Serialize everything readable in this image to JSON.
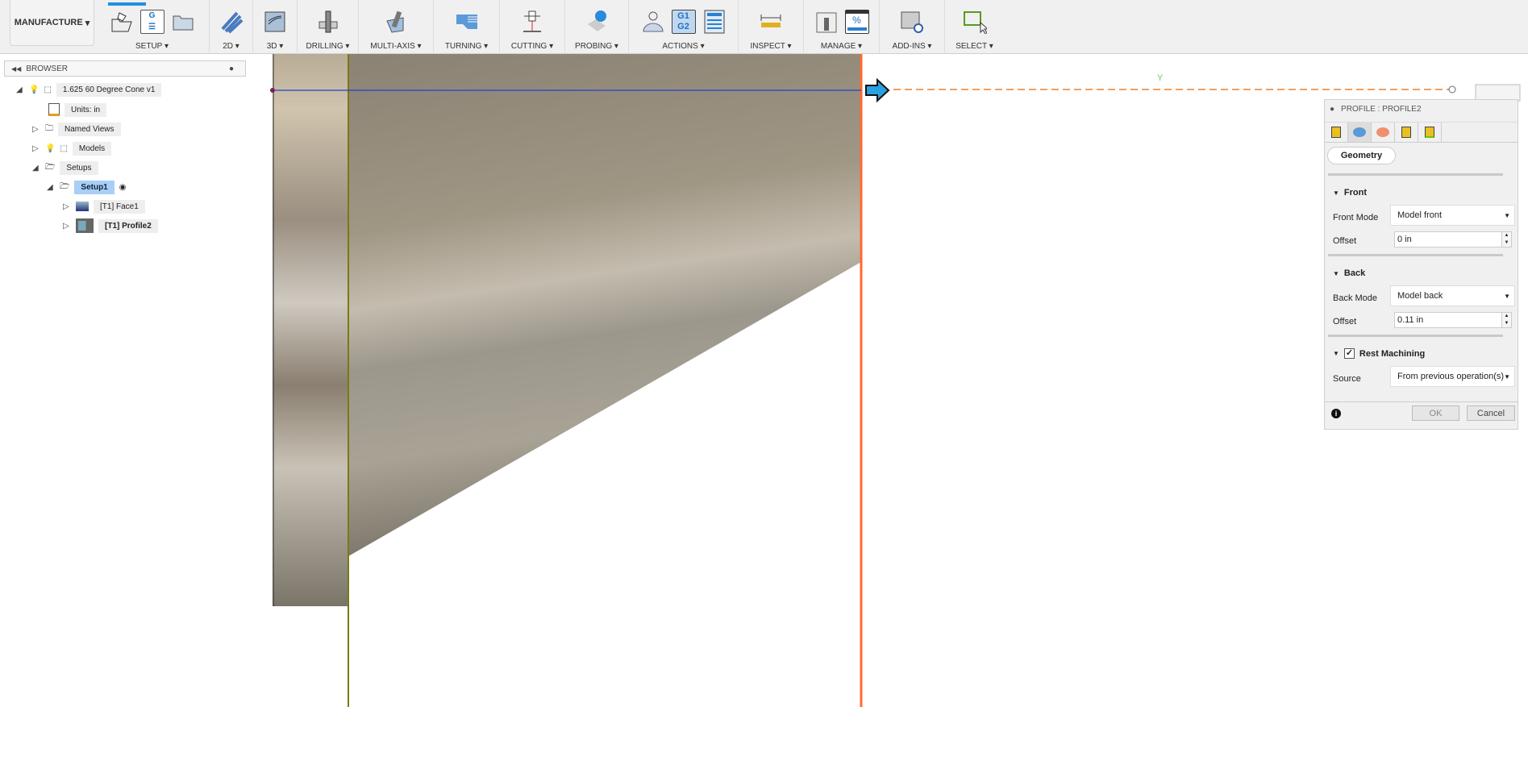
{
  "toolbar": {
    "workspace": "MANUFACTURE",
    "groups": [
      {
        "label": "SETUP"
      },
      {
        "label": "2D"
      },
      {
        "label": "3D"
      },
      {
        "label": "DRILLING"
      },
      {
        "label": "MULTI-AXIS"
      },
      {
        "label": "TURNING"
      },
      {
        "label": "CUTTING"
      },
      {
        "label": "PROBING"
      },
      {
        "label": "ACTIONS"
      },
      {
        "label": "INSPECT"
      },
      {
        "label": "MANAGE"
      },
      {
        "label": "ADD-INS"
      },
      {
        "label": "SELECT"
      }
    ],
    "icon_text": {
      "gcode": "G",
      "g1": "G1",
      "g2": "G2",
      "percent": "%"
    }
  },
  "browser": {
    "title": "BROWSER",
    "items": [
      {
        "label": "1.625 60 Degree Cone v1"
      },
      {
        "label": "Units: in"
      },
      {
        "label": "Named Views"
      },
      {
        "label": "Models"
      },
      {
        "label": "Setups"
      },
      {
        "label": "Setup1"
      },
      {
        "label": "[T1] Face1"
      },
      {
        "label": "[T1] Profile2"
      }
    ]
  },
  "viewport": {
    "axis_y": "Y"
  },
  "panel": {
    "title": "PROFILE : PROFILE2",
    "tab_active": "Geometry",
    "front": {
      "heading": "Front",
      "mode_label": "Front Mode",
      "mode_value": "Model front",
      "offset_label": "Offset",
      "offset_value": "0 in"
    },
    "back": {
      "heading": "Back",
      "mode_label": "Back Mode",
      "mode_value": "Model back",
      "offset_label": "Offset",
      "offset_value": "0.11 in"
    },
    "rest": {
      "heading": "Rest Machining",
      "checked": true,
      "source_label": "Source",
      "source_value": "From previous operation(s)"
    },
    "ok": "OK",
    "cancel": "Cancel"
  },
  "colors": {
    "accent": "#1e90e0",
    "stock_line": "#7a7a10",
    "front_line": "#ff6a30",
    "toolpath": "#f0a060"
  }
}
